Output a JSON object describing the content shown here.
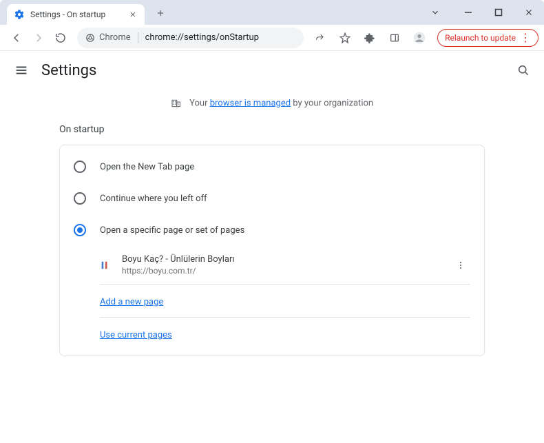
{
  "window": {
    "tab_title": "Settings - On startup",
    "update_label": "Relaunch to update"
  },
  "toolbar": {
    "chrome_label": "Chrome",
    "url": "chrome://settings/onStartup"
  },
  "header": {
    "title": "Settings"
  },
  "managed": {
    "prefix": "Your ",
    "link": "browser is managed",
    "suffix": " by your organization"
  },
  "startup": {
    "section_title": "On startup",
    "options": {
      "new_tab": "Open the New Tab page",
      "continue": "Continue where you left off",
      "specific": "Open a specific page or set of pages"
    },
    "pages": [
      {
        "title": "Boyu Kaç? - Ünlülerin Boyları",
        "url": "https://boyu.com.tr/"
      }
    ],
    "add_page": "Add a new page",
    "use_current": "Use current pages"
  }
}
